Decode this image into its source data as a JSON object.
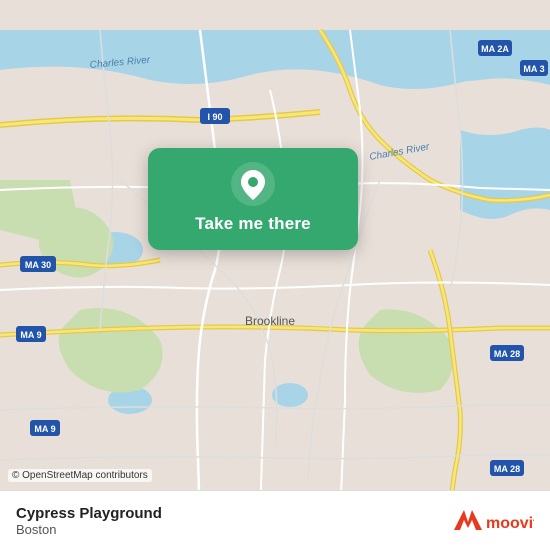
{
  "map": {
    "attribution": "© OpenStreetMap contributors",
    "background_color": "#e8e0d8",
    "center_label": "Brookline"
  },
  "card": {
    "button_label": "Take me there",
    "pin_color": "#ffffff"
  },
  "bottom_bar": {
    "location_name": "Cypress Playground",
    "location_city": "Boston",
    "logo_text": "moovit"
  },
  "road_labels": [
    "Charles River",
    "Charles River",
    "I 90",
    "MA 2A",
    "MA 3",
    "MA 30",
    "MA 9",
    "MA 9",
    "MA 28",
    "MA 28",
    "Brookline"
  ]
}
